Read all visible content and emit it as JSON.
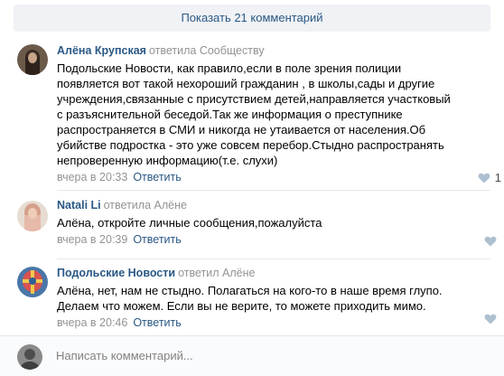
{
  "show_more": {
    "label": "Показать 21 комментарий"
  },
  "comments": [
    {
      "author": "Алёна Крупская",
      "replied": "ответила Сообществу",
      "text": "Подольские Новости, как правило,если в поле зрения полиции появляется вот такой нехороший гражданин , в школы,сады и другие учреждения,связанные с присутствием детей,направляется участковый с разъяснительной беседой.Так же информация о преступнике распространяется в СМИ и никогда не утаивается от населения.Об убийстве подростка - это уже совсем перебор.Стыдно распространять непроверенную информацию(т.е. слухи)",
      "time": "вчера в 20:33",
      "reply_label": "Ответить",
      "likes": "1"
    },
    {
      "author": "Natali Li",
      "replied": "ответила Алёне",
      "text": "Алёна, откройте личные сообщения,пожалуйста",
      "time": "вчера в 20:39",
      "reply_label": "Ответить",
      "likes": ""
    },
    {
      "author": "Подольские Новости",
      "replied": "ответил Алёне",
      "text": "Алёна, нет, нам не стыдно. Полагаться на кого-то в наше время глупо. Делаем что можем. Если вы не верите, то можете приходить мимо.",
      "time": "вчера в 20:46",
      "reply_label": "Ответить",
      "likes": ""
    }
  ],
  "composer": {
    "placeholder": "Написать комментарий..."
  },
  "colors": {
    "link": "#2a5885",
    "muted": "#939393",
    "like_icon": "#aebfd1",
    "button_bg": "#f0f2f5"
  },
  "icons": {
    "like": "heart-icon"
  }
}
